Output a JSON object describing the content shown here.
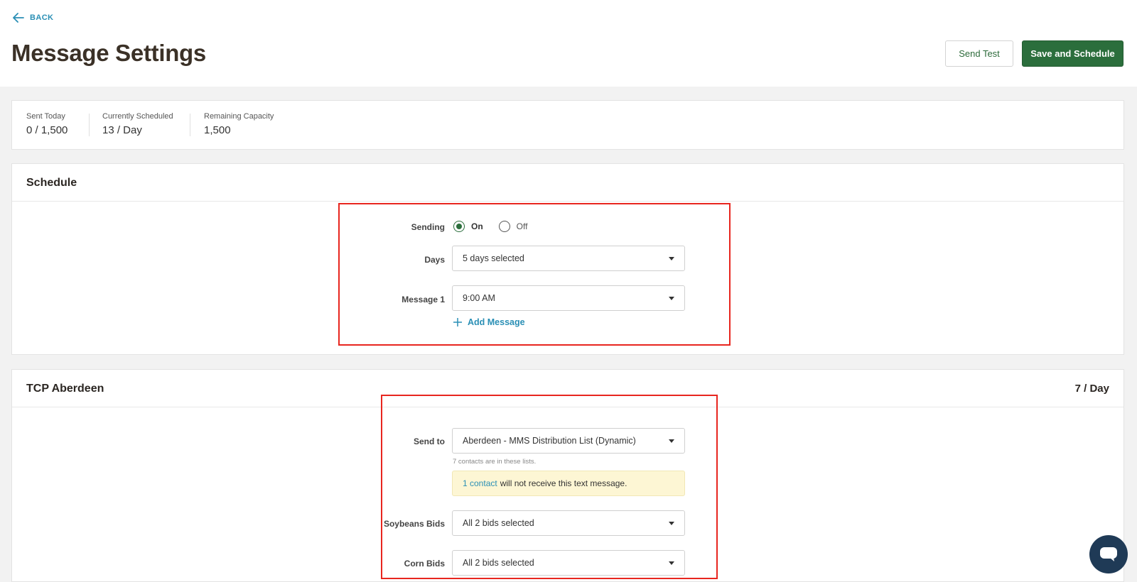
{
  "header": {
    "back_label": "BACK",
    "title": "Message Settings",
    "send_test_label": "Send Test",
    "save_schedule_label": "Save and Schedule"
  },
  "stats": [
    {
      "label": "Sent Today",
      "value": "0 / 1,500"
    },
    {
      "label": "Currently Scheduled",
      "value": "13 / Day"
    },
    {
      "label": "Remaining Capacity",
      "value": "1,500"
    }
  ],
  "schedule": {
    "title": "Schedule",
    "sending_label": "Sending",
    "sending_options": [
      {
        "label": "On",
        "selected": true
      },
      {
        "label": "Off",
        "selected": false
      }
    ],
    "days_label": "Days",
    "days_value": "5 days selected",
    "message1_label": "Message 1",
    "message1_value": "9:00 AM",
    "add_message_label": "Add Message"
  },
  "tcp": {
    "title": "TCP Aberdeen",
    "rate": "7 / Day",
    "send_to_label": "Send to",
    "send_to_value": "Aberdeen - MMS Distribution List (Dynamic)",
    "contacts_hint": "7 contacts are in these lists.",
    "notice_link": "1 contact",
    "notice_text": "will not receive this text message.",
    "soybeans_label": "Soybeans Bids",
    "soybeans_value": "All 2 bids selected",
    "corn_label": "Corn Bids",
    "corn_value": "All 2 bids selected"
  },
  "colors": {
    "primary_green": "#2b6e3c",
    "link_blue": "#2a8fb5",
    "highlight_red": "#e8261f",
    "notice_yellow": "#fdf6d4",
    "chat_navy": "#1f3a56"
  }
}
